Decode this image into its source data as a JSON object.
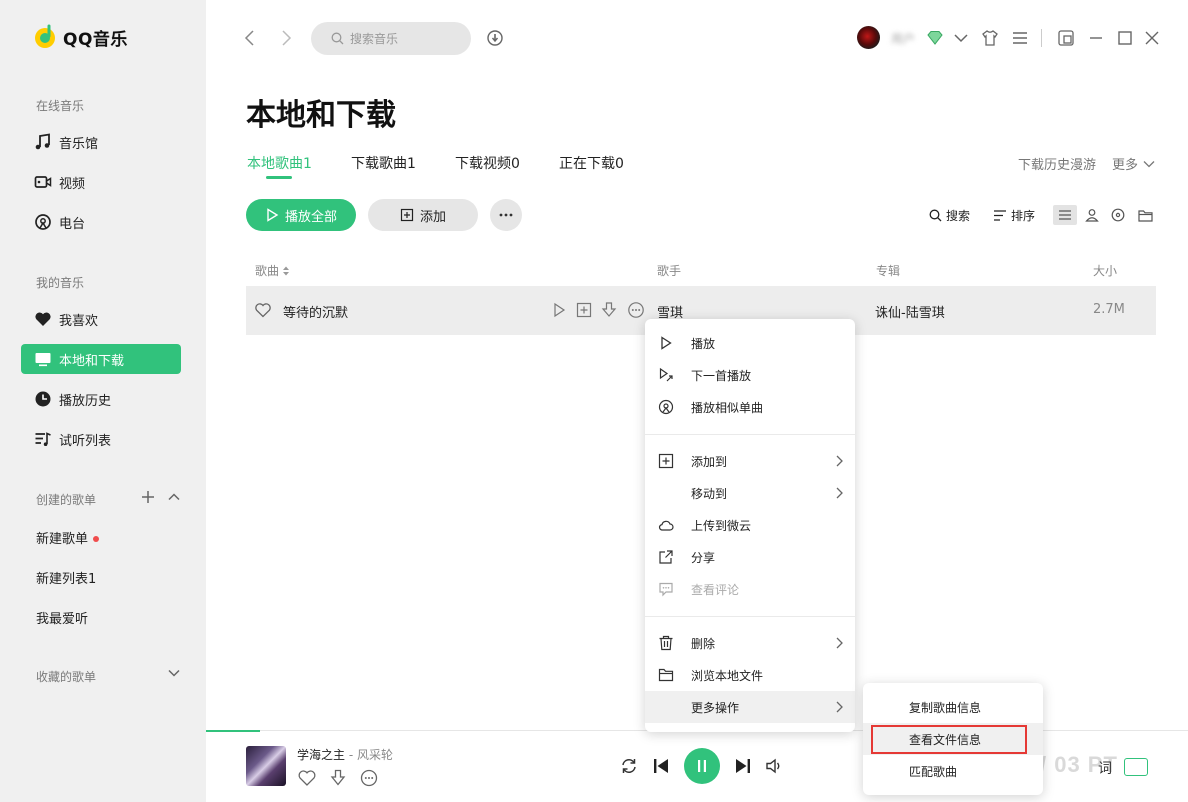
{
  "app": {
    "name": "QQ音乐"
  },
  "sidebar": {
    "online_title": "在线音乐",
    "online_items": [
      {
        "label": "音乐馆",
        "icon": "music-note-icon"
      },
      {
        "label": "视频",
        "icon": "video-icon"
      },
      {
        "label": "电台",
        "icon": "radio-icon"
      }
    ],
    "my_title": "我的音乐",
    "my_items": [
      {
        "label": "我喜欢",
        "icon": "heart-icon"
      },
      {
        "label": "本地和下载",
        "icon": "monitor-icon",
        "active": true
      },
      {
        "label": "播放历史",
        "icon": "history-icon"
      },
      {
        "label": "试听列表",
        "icon": "playlist-icon"
      }
    ],
    "created_title": "创建的歌单",
    "created_items": [
      "新建歌单",
      "新建列表1",
      "我最爱听"
    ],
    "collected_title": "收藏的歌单"
  },
  "topbar": {
    "search_placeholder": "搜索音乐",
    "username": "用户"
  },
  "page": {
    "title": "本地和下载",
    "tabs": [
      {
        "label": "本地歌曲1",
        "active": true
      },
      {
        "label": "下载歌曲1"
      },
      {
        "label": "下载视频0"
      },
      {
        "label": "正在下载0"
      }
    ],
    "history_link": "下载历史漫游",
    "more_link": "更多",
    "play_all": "播放全部",
    "add": "添加",
    "search": "搜索",
    "sort": "排序"
  },
  "table": {
    "headers": {
      "song": "歌曲",
      "artist": "歌手",
      "album": "专辑",
      "size": "大小"
    },
    "rows": [
      {
        "song": "等待的沉默",
        "artist": "雪琪",
        "album": "诛仙-陆雪琪",
        "size": "2.7M"
      }
    ]
  },
  "context_menu": {
    "items": [
      {
        "label": "播放",
        "icon": "play-icon"
      },
      {
        "label": "下一首播放",
        "icon": "play-next-icon"
      },
      {
        "label": "播放相似单曲",
        "icon": "similar-icon"
      },
      {
        "label": "添加到",
        "icon": "add-box-icon"
      },
      {
        "label": "移动到",
        "icon": ""
      },
      {
        "label": "上传到微云",
        "icon": "cloud-icon"
      },
      {
        "label": "分享",
        "icon": "share-icon"
      },
      {
        "label": "查看评论",
        "icon": "comment-icon"
      },
      {
        "label": "删除",
        "icon": "trash-icon"
      },
      {
        "label": "浏览本地文件",
        "icon": "folder-icon"
      },
      {
        "label": "更多操作",
        "icon": ""
      }
    ]
  },
  "submenu": {
    "items": [
      "复制歌曲信息",
      "查看文件信息",
      "匹配歌曲"
    ]
  },
  "player": {
    "title": "学海之主",
    "separator": " - ",
    "artist": "风采轮",
    "progress": 0.055,
    "lyric_btn": "词"
  },
  "watermark": "/ 03 PT",
  "colors": {
    "accent": "#31c27c",
    "highlight": "#e53935"
  }
}
